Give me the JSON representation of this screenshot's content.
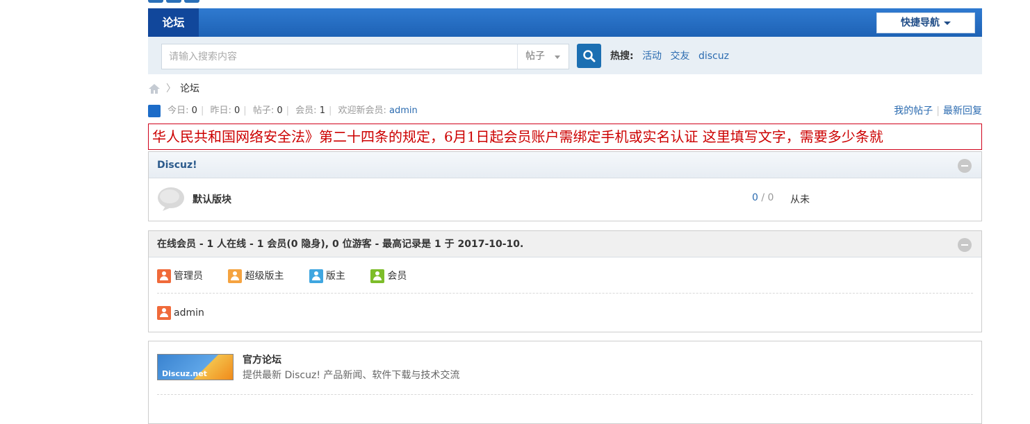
{
  "nav": {
    "tab": "论坛",
    "quick_nav": "快捷导航"
  },
  "search": {
    "placeholder": "请输入搜索内容",
    "type": "帖子",
    "hot_label": "热搜:",
    "hot_items": [
      "活动",
      "交友",
      "discuz"
    ]
  },
  "breadcrumb": {
    "current": "论坛"
  },
  "stats": {
    "today_label": "今日:",
    "today": "0",
    "yesterday_label": "昨日:",
    "yesterday": "0",
    "posts_label": "帖子:",
    "posts": "0",
    "members_label": "会员:",
    "members": "1",
    "welcome_label": "欢迎新会员:",
    "welcome_user": "admin",
    "my_posts": "我的帖子",
    "latest_replies": "最新回复"
  },
  "notice": {
    "text": "华人民共和国网络安全法》第二十四条的规定，6月1日起会员账户需绑定手机或实名认证    这里填写文字，需要多少条就"
  },
  "category": {
    "title": "Discuz!",
    "forum": {
      "name": "默认版块",
      "threads": "0",
      "sep": "/",
      "posts": "0",
      "last_post": "从未"
    }
  },
  "online": {
    "title": "在线会员 - 1 人在线 - 1 会员(0 隐身), 0 位游客 - 最高记录是 1 于 2017-10-10.",
    "legend": [
      "管理员",
      "超级版主",
      "版主",
      "会员"
    ],
    "users": [
      "admin"
    ]
  },
  "links": {
    "logo_text": "Discuz.net",
    "title": "官方论坛",
    "desc": "提供最新 Discuz! 产品新闻、软件下载与技术交流"
  },
  "colors": {
    "nav": "#1e62b5",
    "link": "#2b6bb0",
    "notice": "#cc0000"
  }
}
